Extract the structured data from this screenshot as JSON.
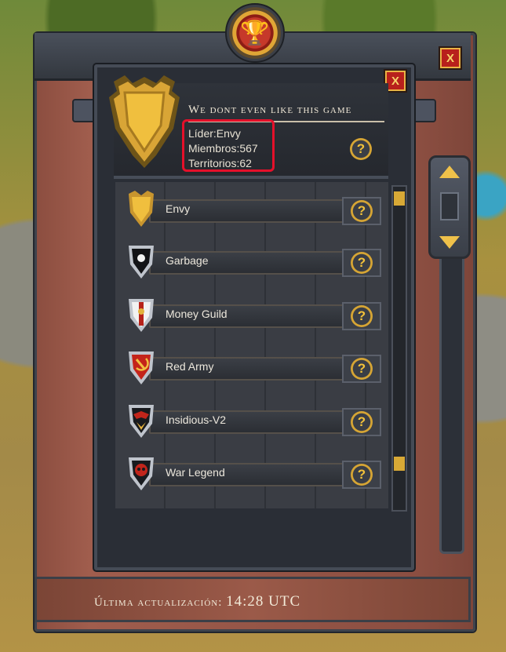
{
  "guild": {
    "name": "We dont even like this game",
    "leader": "Líder:Envy",
    "members": "Miembros:567",
    "territories": "Territorios:62"
  },
  "buttons": {
    "close": "X",
    "help": "?"
  },
  "guild_list": [
    {
      "name": "Envy",
      "emblem_icon": "gold-shield-icon"
    },
    {
      "name": "Garbage",
      "emblem_icon": "black-star-shield-icon"
    },
    {
      "name": "Money Guild",
      "emblem_icon": "white-fleur-shield-icon"
    },
    {
      "name": "Red Army",
      "emblem_icon": "hammer-sickle-shield-icon"
    },
    {
      "name": "Insidious-V2",
      "emblem_icon": "bat-shield-icon"
    },
    {
      "name": "War Legend",
      "emblem_icon": "red-skull-shield-icon"
    }
  ],
  "footer": {
    "label": "Última actualización:",
    "time": "14:28 UTC"
  },
  "colors": {
    "accent_gold": "#efc14a",
    "highlight_red": "#e5102a",
    "wood": "#9b5a49"
  }
}
